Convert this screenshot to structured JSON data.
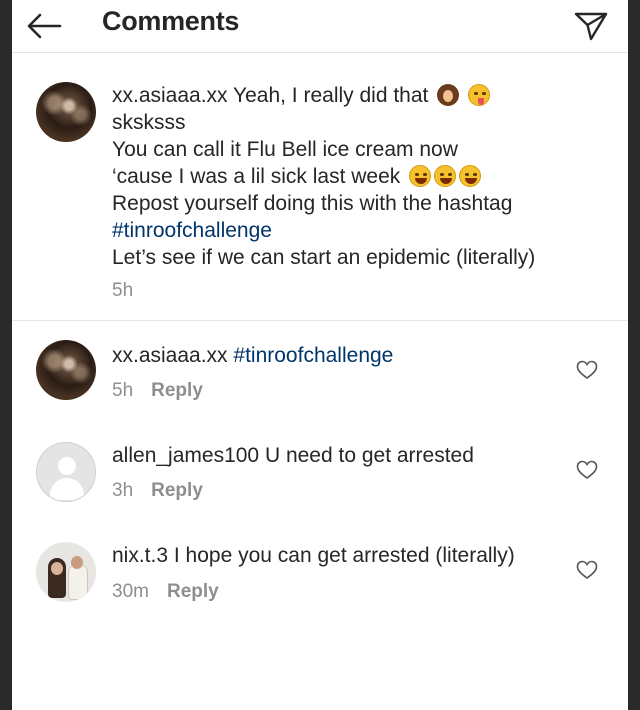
{
  "header": {
    "title": "Comments",
    "back_icon": "arrow-left-icon",
    "direct_icon": "paper-plane-icon"
  },
  "caption": {
    "username": "xx.asiaaa.xx",
    "line1": " Yeah, I really did that",
    "line2": "sksksss",
    "line3": "You can call it Flu Bell ice cream now",
    "line4": "‘cause I was a lil sick last week",
    "line5": "Repost yourself doing this with the hashtag",
    "hashtag": "#tinroofchallenge",
    "line6": "Let’s see if we can start an epidemic (literally)",
    "time": "5h",
    "emojis_line1": [
      "woman-shrugging-emoji",
      "zany-face-emoji"
    ],
    "emojis_line4": [
      "grinning-sweat-emoji",
      "grinning-sweat-emoji",
      "weary-face-emoji"
    ]
  },
  "comments": [
    {
      "username": "xx.asiaaa.xx",
      "text": "",
      "hashtag": "#tinroofchallenge",
      "time": "5h",
      "reply": "Reply"
    },
    {
      "username": "allen_james100",
      "text": " U need to get arrested",
      "time": "3h",
      "reply": "Reply"
    },
    {
      "username": "nix.t.3",
      "text": " I hope you can get arrested (literally)",
      "time": "30m",
      "reply": "Reply"
    }
  ],
  "colors": {
    "hashtag": "#003569",
    "meta": "#8e8e8e",
    "text": "#262626"
  }
}
